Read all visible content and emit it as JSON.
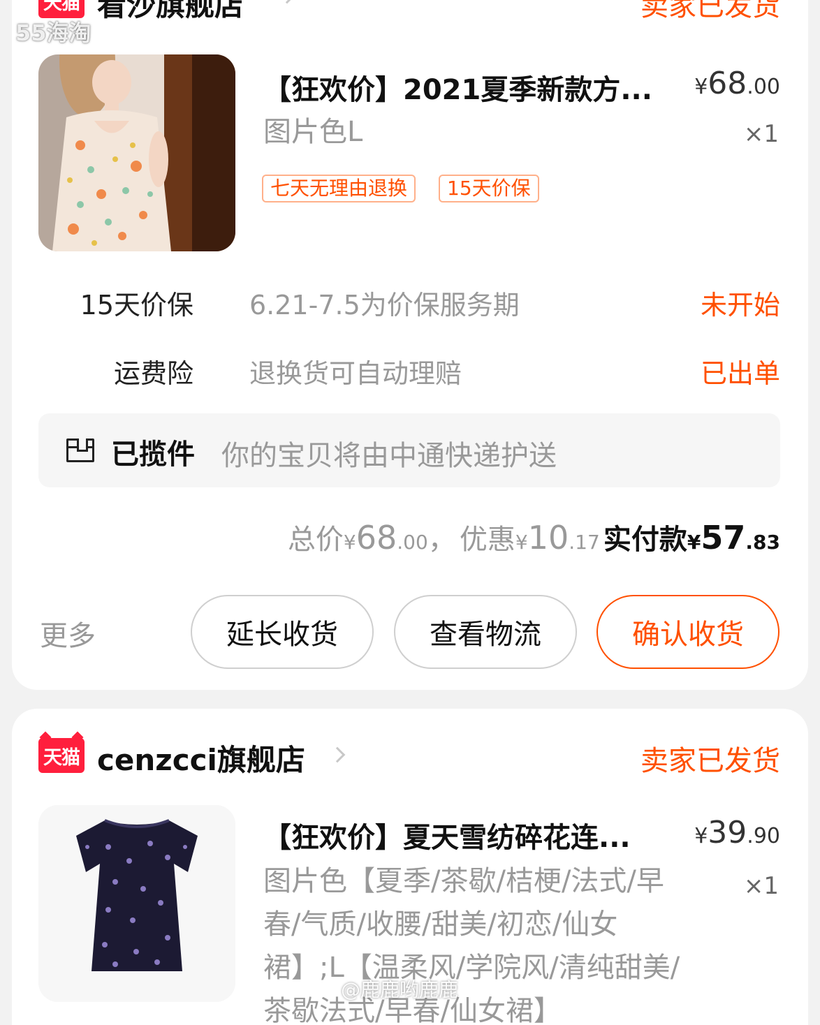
{
  "watermarks": {
    "top_left": "55海淘",
    "bottom": "@鹿鹿哟鹿鹿"
  },
  "orders": [
    {
      "shop": {
        "logo_text": "天猫",
        "name": "看沙旗舰店",
        "status": "卖家已发货"
      },
      "item": {
        "title": "【狂欢价】2021夏季新款方...",
        "price_symbol": "¥",
        "price_int": "68",
        "price_dec": ".00",
        "spec": "图片色L",
        "qty": "×1",
        "tags": [
          "七天无理由退换",
          "15天价保"
        ]
      },
      "services": [
        {
          "name": "15天价保",
          "desc": "6.21-7.5为价保服务期",
          "status": "未开始"
        },
        {
          "name": "运费险",
          "desc": "退换货可自动理赔",
          "status": "已出单"
        }
      ],
      "logistics": {
        "status": "已揽件",
        "desc": "你的宝贝将由中通快递护送"
      },
      "totals": {
        "total_label": "总价",
        "total_symbol": "¥",
        "total_int": "68",
        "total_dec": ".00",
        "separator": "，",
        "discount_label": "优惠",
        "discount_symbol": "¥",
        "discount_int": "10",
        "discount_dec": ".17",
        "paid_label": "实付款",
        "paid_symbol": "¥",
        "paid_int": "57",
        "paid_dec": ".83"
      },
      "actions": {
        "more": "更多",
        "extend": "延长收货",
        "logistics": "查看物流",
        "confirm": "确认收货"
      }
    },
    {
      "shop": {
        "logo_text": "天猫",
        "name": "cenzcci旗舰店",
        "status": "卖家已发货"
      },
      "item": {
        "title": "【狂欢价】夏天雪纺碎花连...",
        "price_symbol": "¥",
        "price_int": "39",
        "price_dec": ".90",
        "spec": "图片色【夏季/茶歇/桔梗/法式/早春/气质/收腰/甜美/初恋/仙女裙】;L【温柔风/学院风/清纯甜美/茶歇法式/早春/仙女裙】",
        "qty": "×1"
      }
    }
  ],
  "colors": {
    "accent": "#ff5000",
    "tmall": "#ff1f3d",
    "background": "#f2f2f2",
    "card": "#ffffff"
  },
  "icons": {
    "shop_logo": "tmall-cat-icon",
    "chevron": "chevron-right-icon",
    "logistics": "package-box-icon"
  }
}
